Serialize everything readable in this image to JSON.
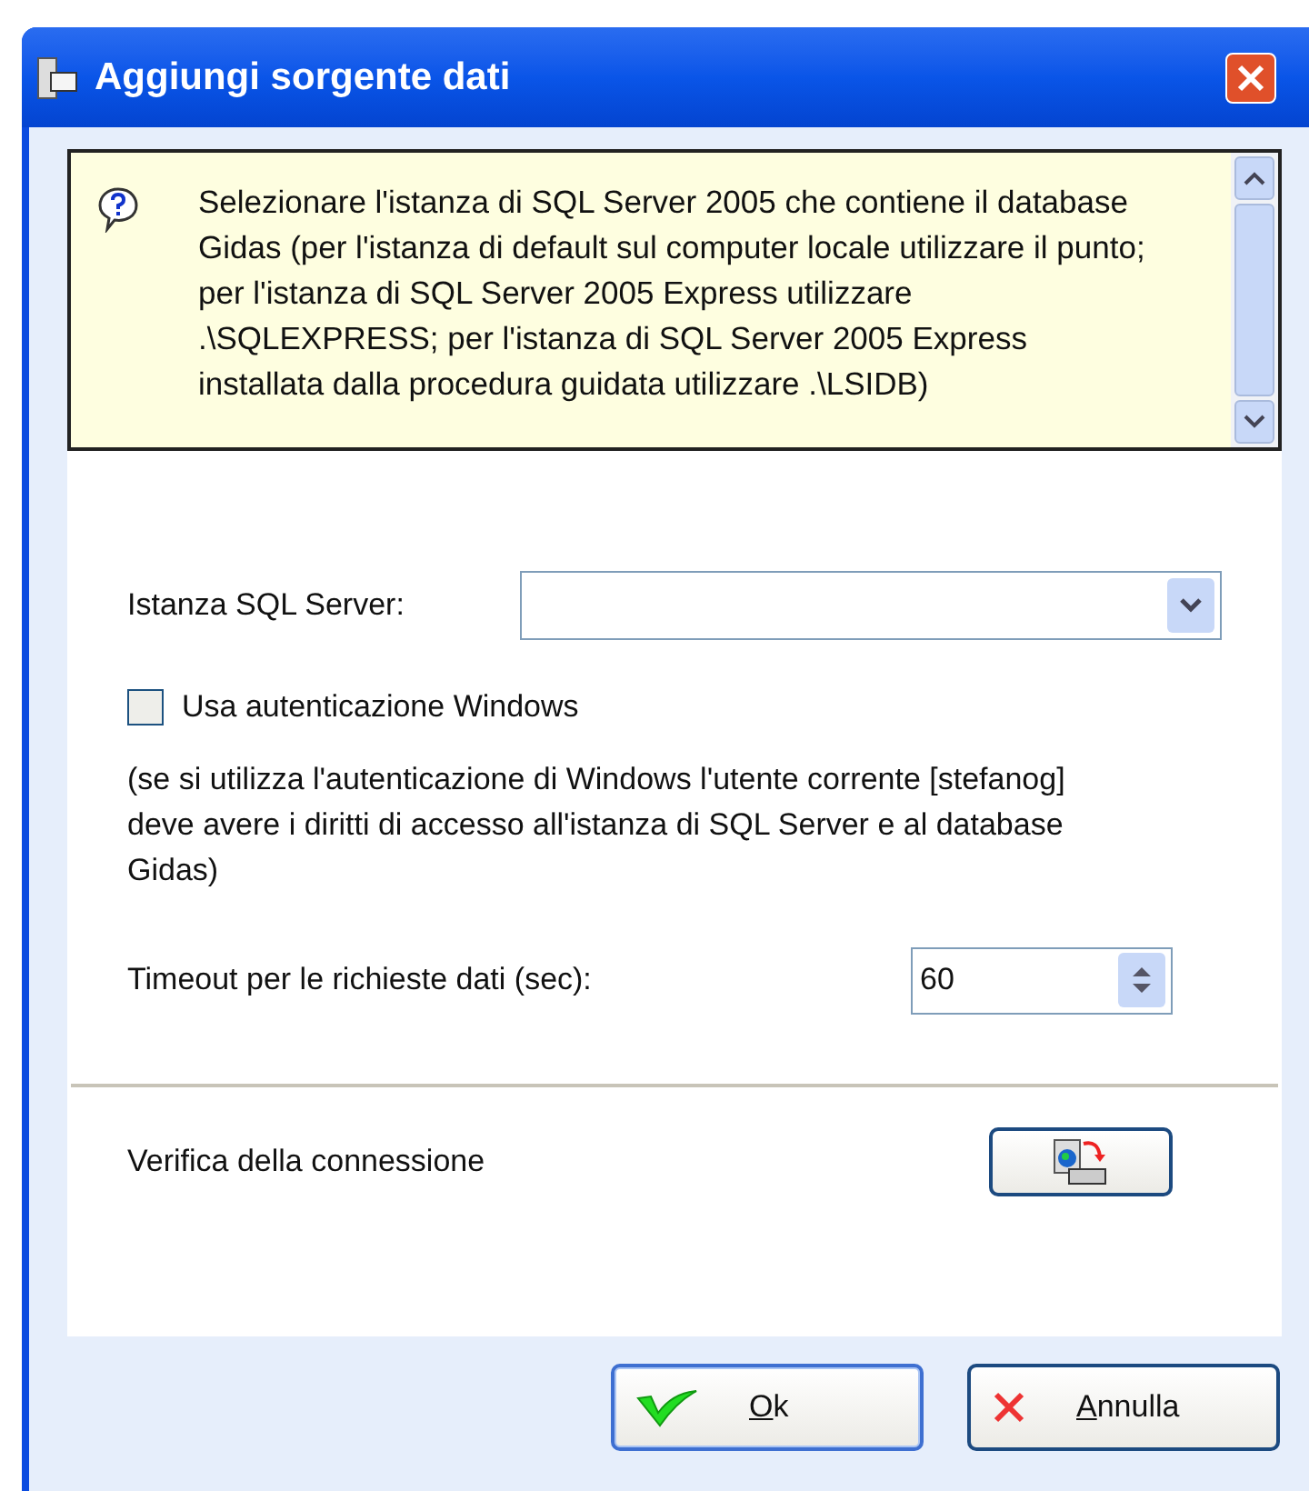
{
  "window": {
    "title": "Aggiungi sorgente dati"
  },
  "info": {
    "text": "Selezionare l'istanza di SQL Server 2005 che contiene il database Gidas (per l'istanza di default sul computer locale utilizzare il punto; per l'istanza di SQL Server 2005 Express utilizzare .\\SQLEXPRESS; per l'istanza di SQL Server 2005 Express installata dalla procedura guidata utilizzare .\\LSIDB)"
  },
  "instance": {
    "label": "Istanza SQL Server:"
  },
  "windows_auth": {
    "label": "Usa autenticazione Windows",
    "checked": false
  },
  "auth_note": "(se si utilizza l'autenticazione di Windows l'utente corrente [stefanog] deve avere i diritti di accesso all'istanza di SQL Server e al database Gidas)",
  "timeout": {
    "label": "Timeout per le richieste dati (sec):",
    "value": "60"
  },
  "verify": {
    "label": "Verifica della connessione"
  },
  "buttons": [
    {
      "kind": "ok",
      "key": "O",
      "rest": "k",
      "default": true
    },
    {
      "kind": "cancel",
      "key": "A",
      "rest": "nnulla",
      "default": false
    }
  ]
}
